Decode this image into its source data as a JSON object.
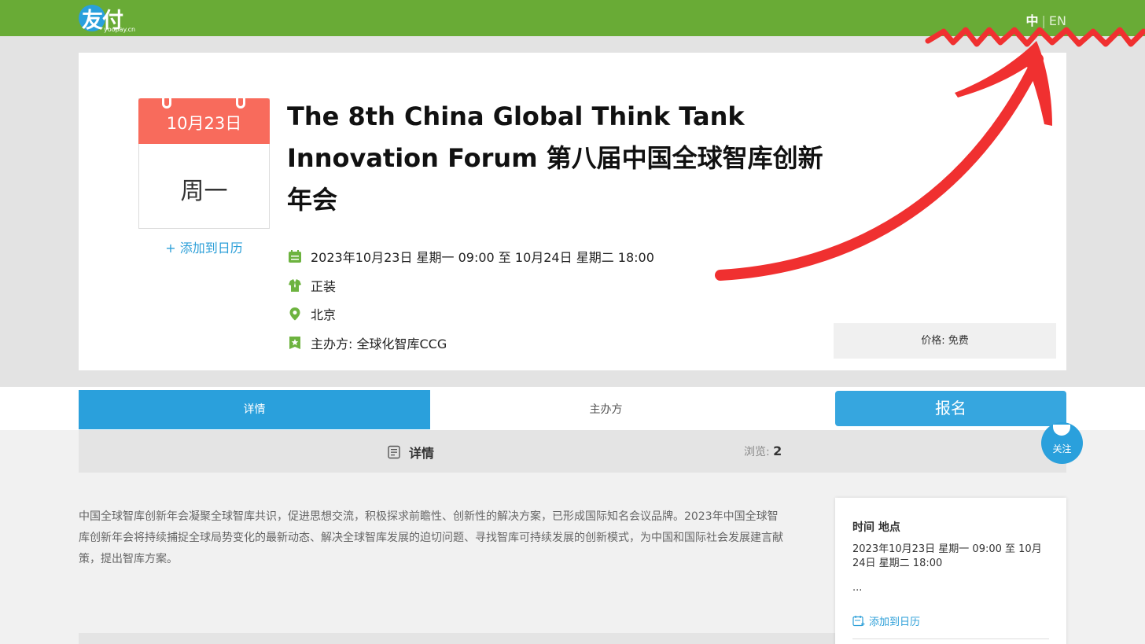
{
  "header": {
    "logo_text": "友付",
    "logo_sub": "yoopay.cn",
    "lang_zh": "中",
    "lang_sep": "|",
    "lang_en": "EN"
  },
  "calendar": {
    "date": "10月23日",
    "weekday": "周一",
    "add_label": "+ 添加到日历"
  },
  "event": {
    "title": "The 8th China Global Think Tank Innovation Forum 第八届中国全球智库创新年会",
    "datetime": "2023年10月23日 星期一 09:00 至 10月24日 星期二 18:00",
    "dress": "正装",
    "location": "北京",
    "organizer": "主办方: 全球化智库CCG",
    "price": "价格: 免费"
  },
  "tabs": {
    "detail": "详情",
    "organizer": "主办方",
    "signup": "报名"
  },
  "detail": {
    "heading": "详情",
    "views_label": "浏览: ",
    "views_count": "2",
    "follow": "关注",
    "description": "中国全球智库创新年会凝聚全球智库共识，促进思想交流，积极探求前瞻性、创新性的解决方案，已形成国际知名会议品牌。2023年中国全球智库创新年会将持续捕捉全球局势变化的最新动态、解决全球智库发展的迫切问题、寻找智库可持续发展的创新模式，为中国和国际社会发展建言献策，提出智库方案。"
  },
  "sidebar": {
    "title": "时间 地点",
    "time": "2023年10月23日 星期一 09:00 至 10月24日 星期二 18:00",
    "place": "...",
    "add_label": "添加到日历"
  },
  "colors": {
    "topbar": "#69ab36",
    "accent_blue": "#2aa0dc",
    "calendar_red": "#f86b5c",
    "icon_green": "#6db33f",
    "annotation_red": "#f03030"
  }
}
